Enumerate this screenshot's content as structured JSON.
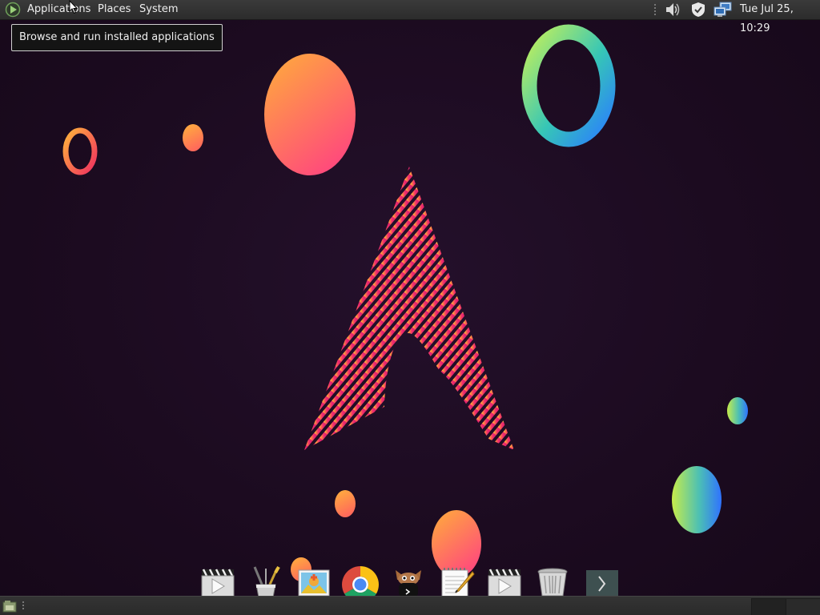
{
  "top_panel": {
    "menus": [
      {
        "label": "Applications"
      },
      {
        "label": "Places"
      },
      {
        "label": "System"
      }
    ],
    "tray_icons": [
      "volume-icon",
      "shield-icon",
      "network-icon"
    ],
    "clock": "Tue Jul 25, 10:29"
  },
  "tooltip": {
    "text": "Browse and run installed applications"
  },
  "dock": {
    "items": [
      "video-player-icon",
      "paint-brushes-icon",
      "image-viewer-icon",
      "chrome-browser-icon",
      "terminal-mascot-icon",
      "text-editor-icon",
      "video-player-icon",
      "trash-icon",
      "dock-arrow-icon"
    ]
  },
  "bottom_panel": {
    "workspaces": [
      "workspace-1",
      "workspace-2"
    ]
  },
  "colors": {
    "background": "#1c0b20",
    "panel": "#2f2f2f",
    "accent_pink": "#e8246e",
    "accent_orange": "#ff9a3c"
  }
}
